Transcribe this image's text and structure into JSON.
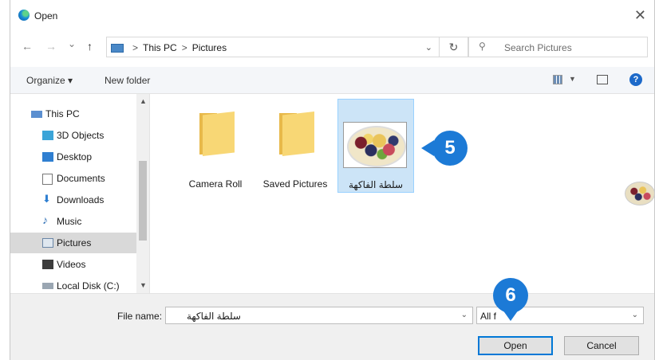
{
  "window": {
    "title": "Open",
    "close_glyph": "✕"
  },
  "nav": {
    "back": "←",
    "forward": "→",
    "recent": "⌄",
    "up": "↑",
    "breadcrumb": [
      "This PC",
      "Pictures"
    ],
    "crumb_separator": ">",
    "refresh": "↻",
    "search_placeholder": "Search Pictures"
  },
  "toolbar": {
    "organize_label": "Organize ▾",
    "new_folder_label": "New folder",
    "help_label": "?"
  },
  "sidebar": {
    "items": [
      {
        "label": "This PC",
        "icon": "computer-icon"
      },
      {
        "label": "3D Objects",
        "icon": "cube-icon"
      },
      {
        "label": "Desktop",
        "icon": "desktop-icon"
      },
      {
        "label": "Documents",
        "icon": "document-icon"
      },
      {
        "label": "Downloads",
        "icon": "download-icon"
      },
      {
        "label": "Music",
        "icon": "music-icon"
      },
      {
        "label": "Pictures",
        "icon": "pictures-icon",
        "selected": true
      },
      {
        "label": "Videos",
        "icon": "video-icon"
      },
      {
        "label": "Local Disk (C:)",
        "icon": "disk-icon"
      }
    ]
  },
  "files": [
    {
      "name": "Camera Roll",
      "type": "folder"
    },
    {
      "name": "Saved Pictures",
      "type": "folder"
    },
    {
      "name": "سلطة الفاكهة",
      "type": "image",
      "selected": true
    }
  ],
  "steps": {
    "step5": "5",
    "step6": "6"
  },
  "footer": {
    "file_name_label": "File name:",
    "file_name_value": "سلطة الفاكهة",
    "filter_value": "All f",
    "open_label": "Open",
    "cancel_label": "Cancel"
  },
  "colors": {
    "accent": "#0078d7",
    "marker": "#1c7ad6",
    "selection": "#cce4f7"
  }
}
